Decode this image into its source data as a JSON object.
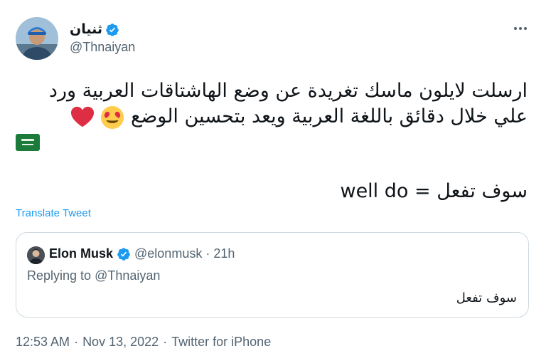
{
  "author": {
    "display_name": "ثنيان",
    "handle": "@Thnaiyan",
    "verified": true,
    "avatar_icon": "avatar-photo"
  },
  "tweet": {
    "line1": "ارسلت لايلون ماسك تغريدة عن وضع الهاشتاقات العربية ورد",
    "line2": "علي خلال دقائق باللغة العربية ويعد بتحسين الوضع",
    "emojis": [
      "heart-eyes-emoji",
      "red-heart-emoji"
    ],
    "flag_icon": "saudi-flag-emoji",
    "line3": "سوف تفعل = well do"
  },
  "translate_label": "Translate Tweet",
  "quote": {
    "name": "Elon Musk",
    "handle": "@elonmusk",
    "separator": "·",
    "time": "21h",
    "replying_prefix": "Replying to",
    "replying_to": "@Thnaiyan",
    "text": "سوف تفعل"
  },
  "footer": {
    "time": "12:53 AM",
    "sep1": "·",
    "date": "Nov 13, 2022",
    "sep2": "·",
    "source": "Twitter for iPhone"
  },
  "colors": {
    "accent": "#1d9bf0",
    "secondary_text": "#536471",
    "border": "#cfd9de"
  }
}
